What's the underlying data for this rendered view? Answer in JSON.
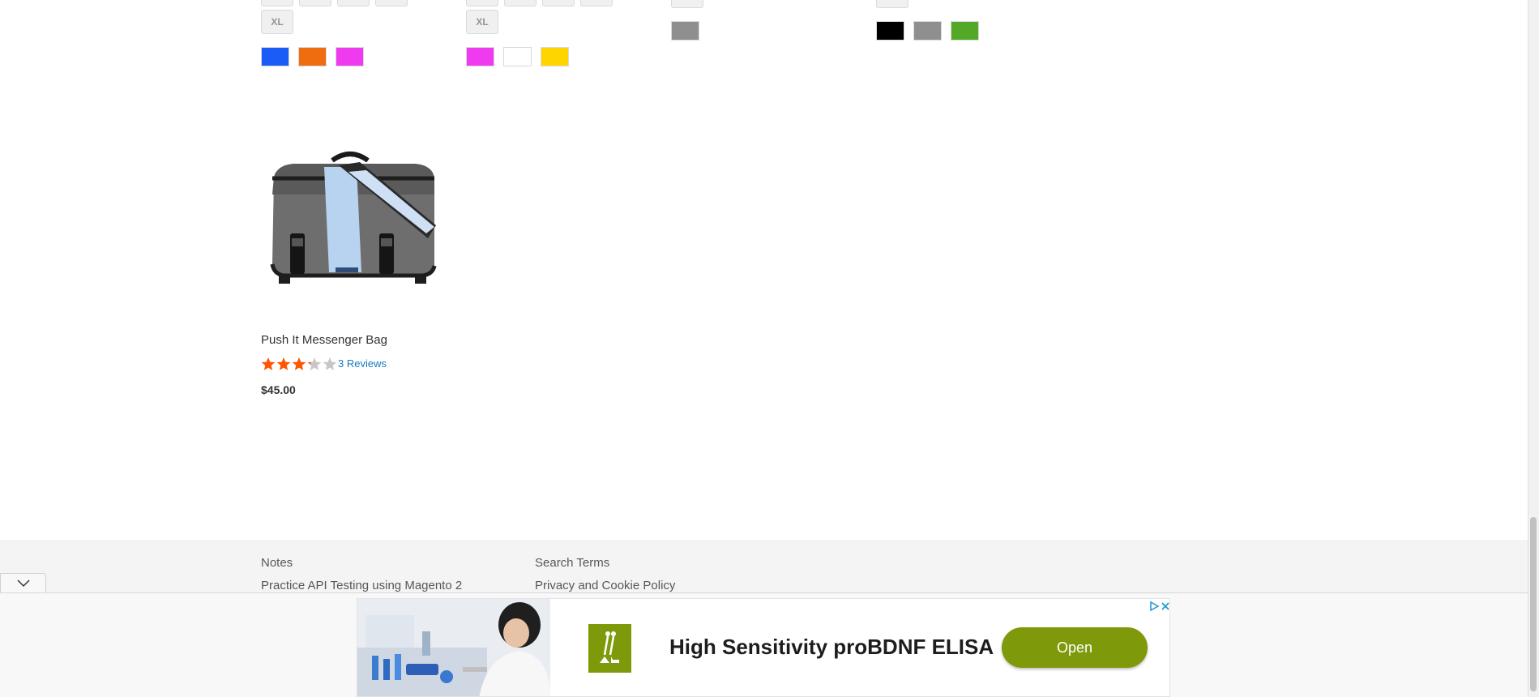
{
  "grid": {
    "col1": {
      "sizes_visible": [
        "XL"
      ],
      "colors": [
        "#1a5cf5",
        "#ef6c0f",
        "#ef3af0"
      ]
    },
    "col2": {
      "sizes_visible": [
        "XL"
      ],
      "colors": [
        "#ef3af0",
        "#ffffff",
        "#ffd500"
      ]
    },
    "col3": {
      "colors": [
        "#8f8f8f"
      ]
    },
    "col4": {
      "colors": [
        "#000000",
        "#8f8f8f",
        "#53a828"
      ]
    }
  },
  "product": {
    "name": "Push It Messenger Bag",
    "rating_percent": 65,
    "reviews_label": "3 Reviews",
    "price": "$45.00",
    "image_icon": "messenger-bag-image"
  },
  "footer": {
    "links_col1": [
      "Notes",
      "Practice API Testing using Magento 2"
    ],
    "links_col2": [
      "Search Terms",
      "Privacy and Cookie Policy"
    ]
  },
  "ad": {
    "headline": "High Sensitivity proBDNF ELISA",
    "button_label": "Open",
    "accent_color": "#7e9a0a",
    "icons": [
      "adchoices-icon",
      "close-icon",
      "chevron-down-icon"
    ]
  }
}
